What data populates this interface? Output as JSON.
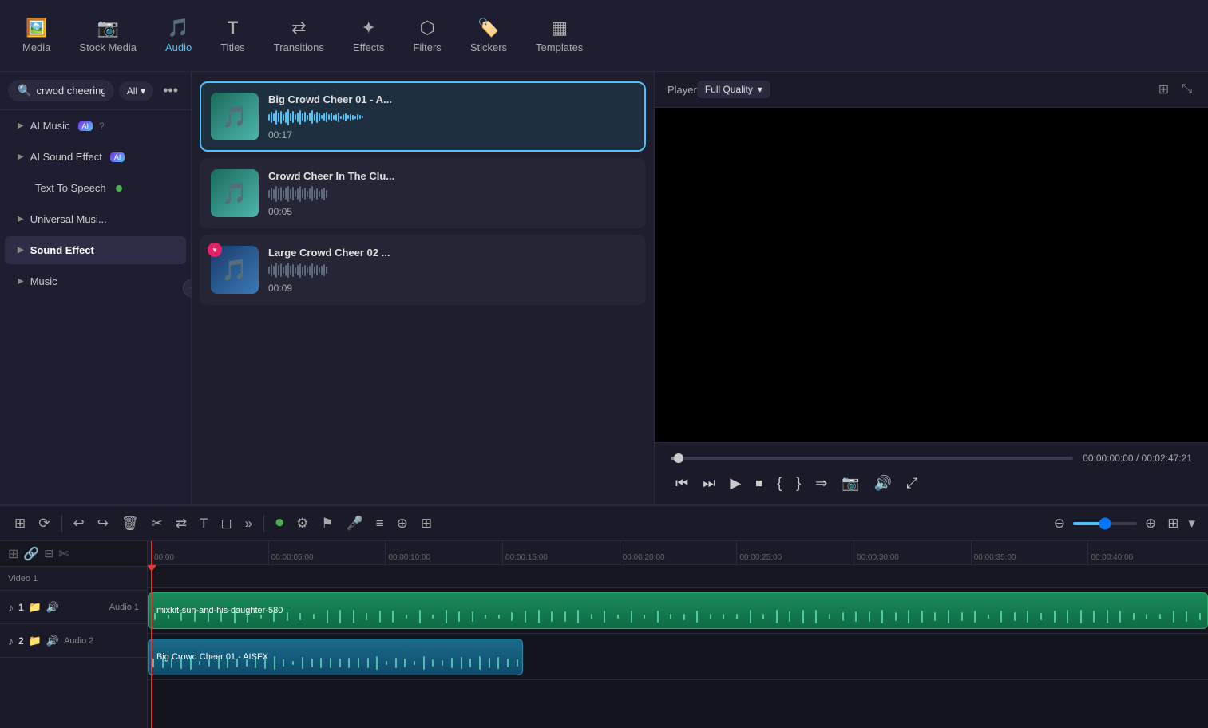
{
  "nav": {
    "items": [
      {
        "id": "media",
        "label": "Media",
        "icon": "🖼",
        "active": false
      },
      {
        "id": "stock-media",
        "label": "Stock Media",
        "icon": "📷",
        "active": false
      },
      {
        "id": "audio",
        "label": "Audio",
        "icon": "🎵",
        "active": true
      },
      {
        "id": "titles",
        "label": "Titles",
        "icon": "T",
        "active": false
      },
      {
        "id": "transitions",
        "label": "Transitions",
        "icon": "⇄",
        "active": false
      },
      {
        "id": "effects",
        "label": "Effects",
        "icon": "✦",
        "active": false
      },
      {
        "id": "filters",
        "label": "Filters",
        "icon": "⬡",
        "active": false
      },
      {
        "id": "stickers",
        "label": "Stickers",
        "icon": "🏷",
        "active": false
      },
      {
        "id": "templates",
        "label": "Templates",
        "icon": "▦",
        "active": false
      }
    ]
  },
  "search": {
    "placeholder": "crwod cheering",
    "value": "crwod cheering",
    "filter_label": "All"
  },
  "sidebar": {
    "items": [
      {
        "id": "ai-music",
        "label": "AI Music",
        "has_ai": true,
        "chevron": true,
        "active": false
      },
      {
        "id": "ai-sound-effect",
        "label": "AI Sound Effect",
        "has_ai": true,
        "chevron": true,
        "active": false
      },
      {
        "id": "text-to-speech",
        "label": "Text To Speech",
        "dot": true,
        "active": false
      },
      {
        "id": "universal-music",
        "label": "Universal Musi...",
        "chevron": true,
        "active": false
      },
      {
        "id": "sound-effect",
        "label": "Sound Effect",
        "chevron": true,
        "active": true
      },
      {
        "id": "music",
        "label": "Music",
        "chevron": true,
        "active": false
      }
    ]
  },
  "audio_results": [
    {
      "id": "result1",
      "title": "Big Crowd Cheer 01 - A...",
      "duration": "00:17",
      "selected": true,
      "has_heart": false
    },
    {
      "id": "result2",
      "title": "Crowd Cheer In The Clu...",
      "duration": "00:05",
      "selected": false,
      "has_heart": false
    },
    {
      "id": "result3",
      "title": "Large Crowd Cheer 02 ...",
      "duration": "00:09",
      "selected": false,
      "has_heart": true
    }
  ],
  "player": {
    "label": "Player",
    "quality": "Full Quality",
    "time_current": "00:00:00:00",
    "time_total": "00:02:47:21"
  },
  "timeline": {
    "ruler_marks": [
      "00:00",
      "00:00:05:00",
      "00:00:10:00",
      "00:00:15:00",
      "00:00:20:00",
      "00:00:25:00",
      "00:00:30:00",
      "00:00:35:00",
      "00:00:40:00"
    ],
    "tracks": [
      {
        "id": "video1",
        "label": "Video 1",
        "type": "video"
      },
      {
        "id": "audio1",
        "num": "♪ 1",
        "label": "Audio 1",
        "clip": "mixkit-sun-and-his-daughter-580",
        "type": "audio"
      },
      {
        "id": "audio2",
        "num": "♪ 2",
        "label": "Audio 2",
        "clip": "Big Crowd Cheer 01 - AISFX",
        "type": "audio"
      }
    ]
  },
  "toolbar": {
    "buttons": [
      "⊞",
      "⟳",
      "|",
      "↩",
      "↪",
      "🗑",
      "✂",
      "⇄",
      "T",
      "◻",
      "»"
    ]
  }
}
